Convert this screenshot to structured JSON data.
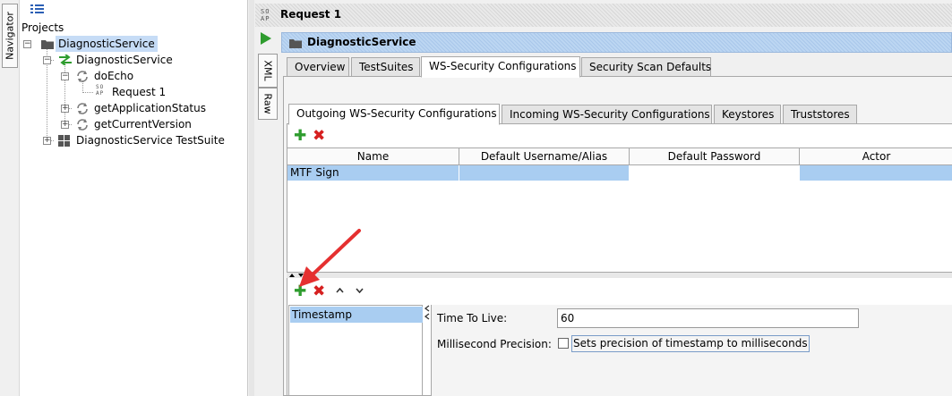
{
  "navigator": {
    "tab_label": "Navigator"
  },
  "tree": {
    "root_label": "Projects",
    "project": "DiagnosticService",
    "interface": "DiagnosticService",
    "operations": [
      {
        "label": "doEcho",
        "children": [
          "Request 1"
        ]
      },
      {
        "label": "getApplicationStatus",
        "children": []
      },
      {
        "label": "getCurrentVersion",
        "children": []
      }
    ],
    "testsuite": "DiagnosticService TestSuite",
    "request_icon_text": [
      "SO",
      "AP"
    ]
  },
  "editor": {
    "title": "Request 1",
    "title_icon_text": [
      "SO",
      "AP"
    ],
    "side_tabs": [
      "XML",
      "Raw"
    ]
  },
  "service": {
    "title": "DiagnosticService",
    "tabs": [
      "Overview",
      "TestSuites",
      "WS-Security Configurations",
      "Security Scan Defaults"
    ],
    "active_tab": "WS-Security Configurations",
    "subtabs": [
      "Outgoing WS-Security Configurations",
      "Incoming WS-Security Configurations",
      "Keystores",
      "Truststores"
    ],
    "active_subtab": "Outgoing WS-Security Configurations"
  },
  "table": {
    "columns": [
      "Name",
      "Default Username/Alias",
      "Default Password",
      "Actor"
    ],
    "rows": [
      {
        "name": "MTF Sign",
        "username": "",
        "password": "",
        "actor": ""
      }
    ]
  },
  "entries": {
    "list": [
      "Timestamp"
    ],
    "time_to_live_label": "Time To Live:",
    "time_to_live_value": "60",
    "millisecond_label": "Millisecond Precision:",
    "millisecond_checkbox_text": "Sets precision of timestamp to milliseconds",
    "millisecond_checked": false
  },
  "colors": {
    "selection": "#a9cdf1",
    "add": "#2e9c2e",
    "remove": "#d62020",
    "annotation_arrow": "#e53030"
  },
  "icons": [
    "view-icon",
    "folder-icon",
    "interface-icon",
    "operation-icon",
    "soap-request-icon",
    "testsuite-icon",
    "play-icon",
    "add-icon",
    "remove-icon",
    "move-up-icon",
    "move-down-icon",
    "annotation-arrow"
  ]
}
